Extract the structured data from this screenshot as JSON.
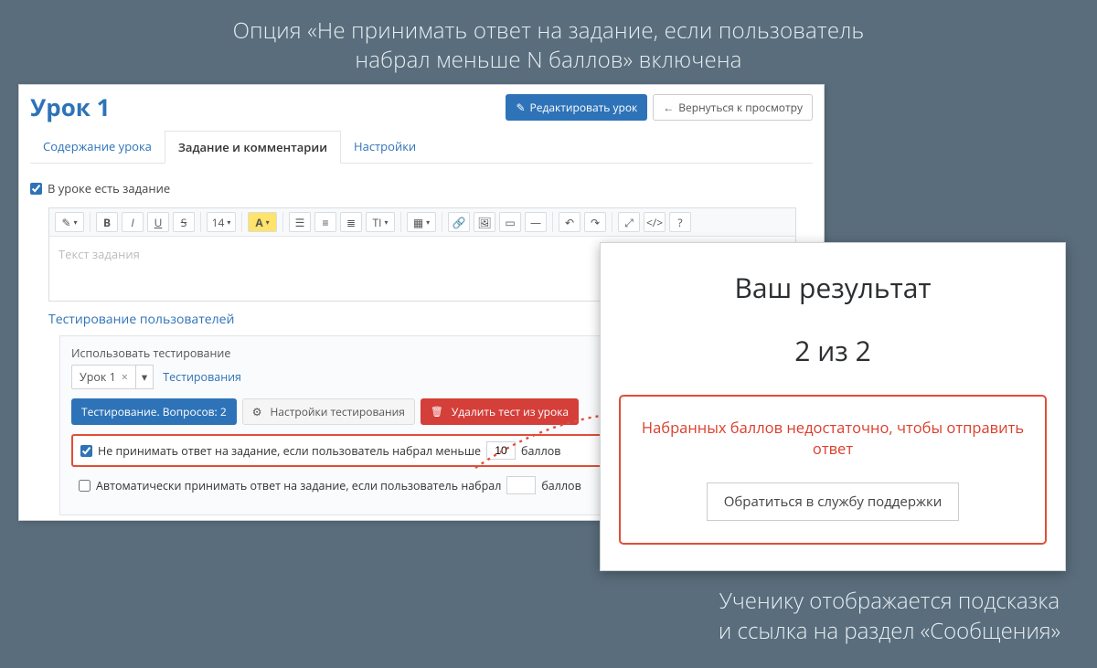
{
  "captions": {
    "top": "Опция «Не принимать ответ на задание, если пользователь\nнабрал меньше N баллов» включена",
    "bottom": "Ученику отображается подсказка\nи ссылка на раздел «Сообщения»"
  },
  "admin": {
    "title": "Урок 1",
    "header_buttons": {
      "edit": "Редактировать урок",
      "back": "Вернуться к просмотру"
    },
    "tabs": {
      "content": "Содержание урока",
      "assignment": "Задание и комментарии",
      "settings": "Настройки"
    },
    "has_assignment_label": "В уроке есть задание",
    "editor_placeholder": "Текст задания",
    "testing_section_title": "Тестирование пользователей",
    "use_testing_label": "Использовать тестирование",
    "chip_label": "Урок 1",
    "chip_link_label": "Тестирования",
    "test_toolbar": {
      "info": "Тестирование. Вопросов: 2",
      "settings": "Настройки тестирования",
      "delete": "Удалить тест из урока"
    },
    "option_reject": {
      "label_before": "Не принимать ответ на задание, если пользователь набрал меньше",
      "value": "10",
      "label_after": "баллов"
    },
    "option_auto": {
      "label_before": "Автоматически принимать ответ на задание, если пользователь набрал",
      "value": "",
      "label_after": "баллов"
    }
  },
  "result": {
    "title": "Ваш результат",
    "score": "2 из 2",
    "message": "Набранных баллов недостаточно, чтобы отправить ответ",
    "support_button": "Обратиться в службу поддержки"
  },
  "icons": {
    "edit": "✎",
    "back": "←"
  }
}
